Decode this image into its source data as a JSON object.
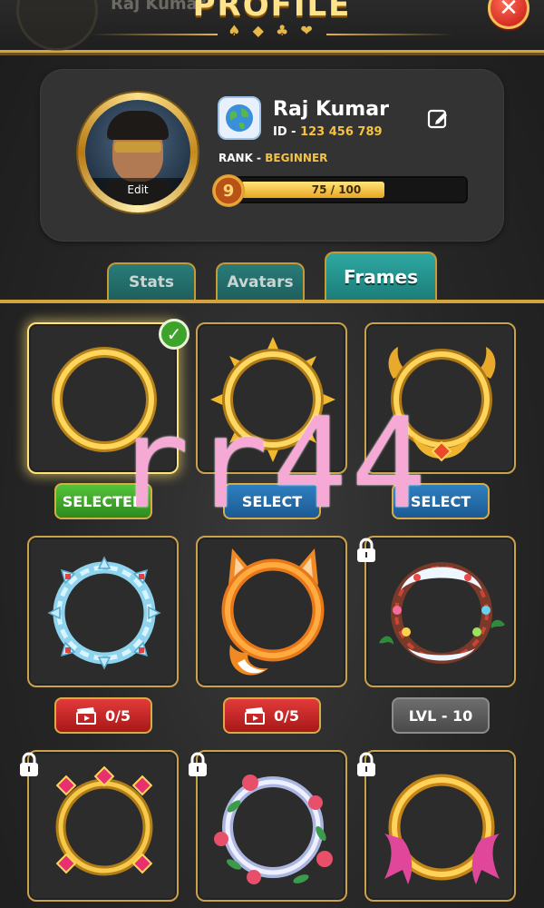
{
  "header": {
    "title": "PROFILE",
    "suits": "♠ ◆ ♣ ❤",
    "ghost_name": "Raj Kumar",
    "close_label": "✕"
  },
  "profile": {
    "avatar_edit_label": "Edit",
    "name": "Raj Kumar",
    "id_prefix": "ID - ",
    "id_value": "123 456 789",
    "rank_prefix": "RANK - ",
    "rank_value": "BEGINNER",
    "level": "9",
    "xp_text": "75 / 100",
    "xp_fraction": 0.75
  },
  "tabs": [
    {
      "label": "Stats",
      "active": false
    },
    {
      "label": "Avatars",
      "active": false
    },
    {
      "label": "Frames",
      "active": true
    }
  ],
  "frames": [
    {
      "style": "plain-gold",
      "selected": true,
      "locked": false,
      "button": {
        "label": "SELECTED",
        "color": "green"
      }
    },
    {
      "style": "sun-gold",
      "selected": false,
      "locked": false,
      "button": {
        "label": "SELECT",
        "color": "blue"
      }
    },
    {
      "style": "ornate-gold",
      "selected": false,
      "locked": false,
      "button": {
        "label": "SELECT",
        "color": "blue"
      }
    },
    {
      "style": "ice-crystal",
      "selected": false,
      "locked": false,
      "button": {
        "label": "0/5",
        "color": "red",
        "icon": "clapperboard-icon"
      }
    },
    {
      "style": "fox-orange",
      "selected": false,
      "locked": false,
      "button": {
        "label": "0/5",
        "color": "red",
        "icon": "clapperboard-icon"
      }
    },
    {
      "style": "christmas-wreath",
      "selected": false,
      "locked": true,
      "button": {
        "label": "LVL - 10",
        "color": "grey"
      }
    },
    {
      "style": "jeweled-gold",
      "selected": false,
      "locked": true
    },
    {
      "style": "floral-pearl",
      "selected": false,
      "locked": true
    },
    {
      "style": "ribbon-gold",
      "selected": false,
      "locked": true
    }
  ],
  "overlay": {
    "watermark": "rr44"
  },
  "colors": {
    "gold": "#d4a43a",
    "teal_tab": "#2ea8a2",
    "select_green": "#3da32b",
    "select_blue": "#2f7fc0",
    "ad_red": "#e23a3a",
    "locked_grey": "#6e6e6e",
    "watermark_pink": "#f7a9d5"
  }
}
